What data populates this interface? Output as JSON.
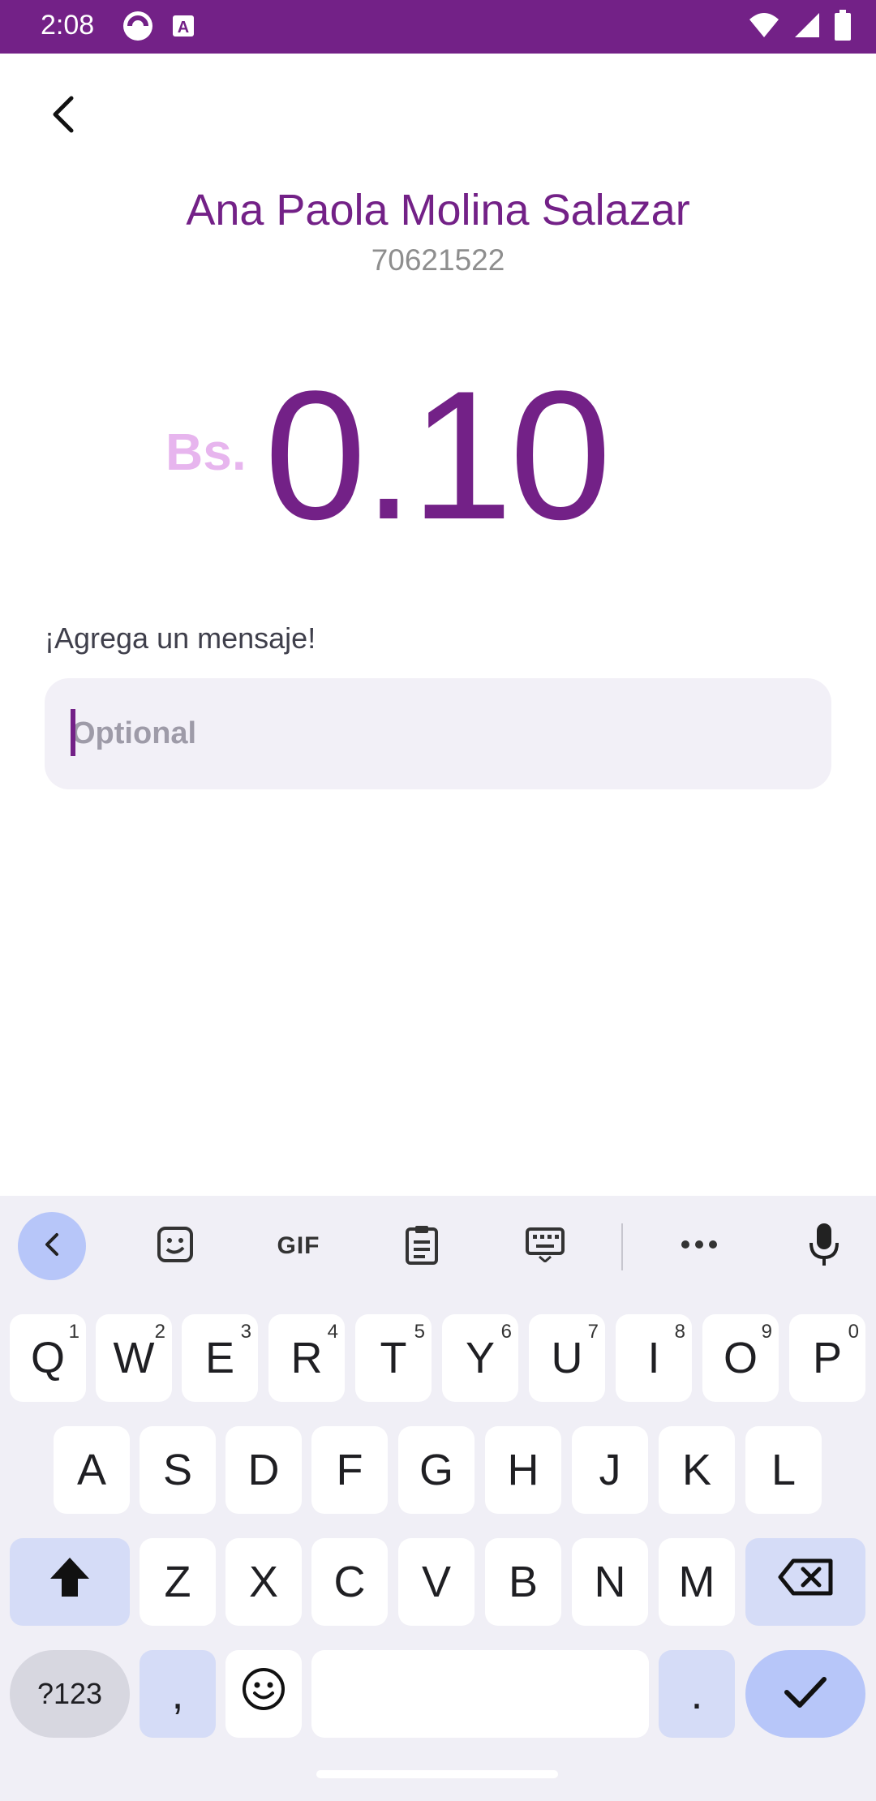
{
  "status_bar": {
    "time": "2:08",
    "icons_left": [
      "record-icon",
      "a-badge-icon"
    ],
    "icons_right": [
      "wifi-icon",
      "signal-icon",
      "battery-icon"
    ],
    "color": "#732187"
  },
  "header": {
    "back_icon": "chevron-left-icon",
    "recipient_name": "Ana Paola Molina Salazar",
    "recipient_phone": "70621522"
  },
  "amount": {
    "currency": "Bs.",
    "value": "0.10"
  },
  "message": {
    "label": "¡Agrega un mensaje!",
    "value": "",
    "placeholder": "Optional"
  },
  "keyboard": {
    "toolbar": {
      "gif_label": "GIF",
      "items": [
        "back-icon",
        "sticker-icon",
        "gif-icon",
        "clipboard-icon",
        "keyboard-icon",
        "more-icon",
        "microphone-icon"
      ]
    },
    "row1": [
      {
        "label": "Q",
        "hint": "1"
      },
      {
        "label": "W",
        "hint": "2"
      },
      {
        "label": "E",
        "hint": "3"
      },
      {
        "label": "R",
        "hint": "4"
      },
      {
        "label": "T",
        "hint": "5"
      },
      {
        "label": "Y",
        "hint": "6"
      },
      {
        "label": "U",
        "hint": "7"
      },
      {
        "label": "I",
        "hint": "8"
      },
      {
        "label": "O",
        "hint": "9"
      },
      {
        "label": "P",
        "hint": "0"
      }
    ],
    "row2": [
      "A",
      "S",
      "D",
      "F",
      "G",
      "H",
      "J",
      "K",
      "L"
    ],
    "row3": [
      "Z",
      "X",
      "C",
      "V",
      "B",
      "N",
      "M"
    ],
    "symbols_label": "?123",
    "comma_label": ",",
    "period_label": ".",
    "accent_color": "#b7c6f9"
  }
}
